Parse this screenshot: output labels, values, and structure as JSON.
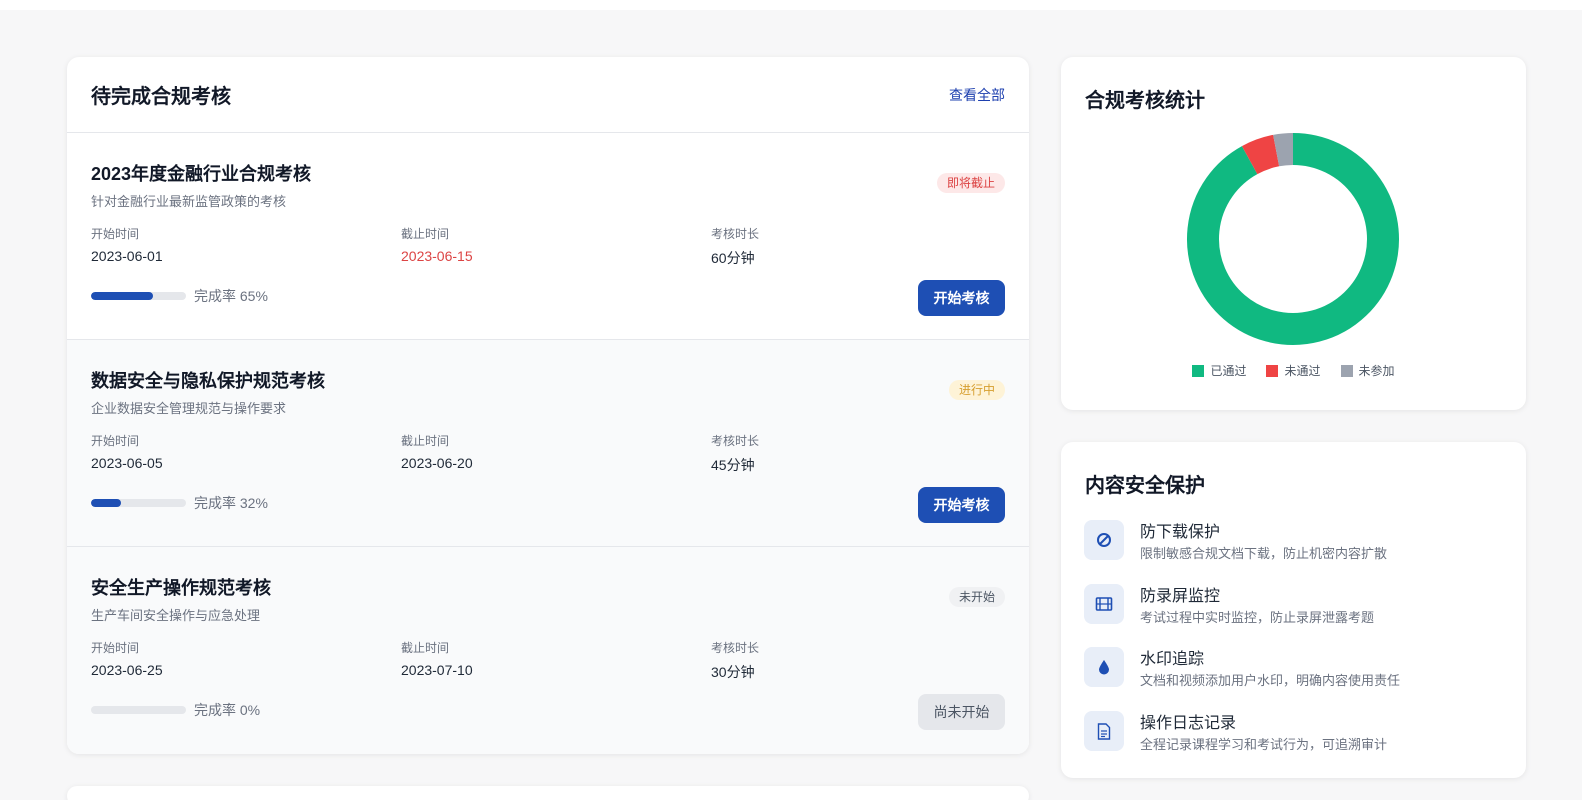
{
  "pending": {
    "title": "待完成合规考核",
    "view_all": "查看全部",
    "start_label": "开始时间",
    "deadline_label": "截止时间",
    "duration_label": "考核时长",
    "exams": [
      {
        "title": "2023年度金融行业合规考核",
        "desc": "针对金融行业最新监管政策的考核",
        "status": "即将截止",
        "status_color": "#dc4444",
        "start": "2023-06-01",
        "deadline": "2023-06-15",
        "duration": "60分钟",
        "progress": 65,
        "progress_text": "完成率 65%",
        "button": "开始考核",
        "button_enabled": true
      },
      {
        "title": "数据安全与隐私保护规范考核",
        "desc": "企业数据安全管理规范与操作要求",
        "status": "进行中",
        "status_color": "#d69e2e",
        "start": "2023-06-05",
        "deadline": "2023-06-20",
        "duration": "45分钟",
        "progress": 32,
        "progress_text": "完成率 32%",
        "button": "开始考核",
        "button_enabled": true
      },
      {
        "title": "安全生产操作规范考核",
        "desc": "生产车间安全操作与应急处理",
        "status": "未开始",
        "status_color": "#4b5563",
        "start": "2023-06-25",
        "deadline": "2023-07-10",
        "duration": "30分钟",
        "progress": 0,
        "progress_text": "完成率 0%",
        "button": "尚未开始",
        "button_enabled": false
      }
    ]
  },
  "stats": {
    "title": "合规考核统计",
    "chart_data": {
      "type": "pie",
      "categories": [
        "已通过",
        "未通过",
        "未参加"
      ],
      "values": [
        92,
        5,
        3
      ],
      "colors": [
        "#10b981",
        "#ef4444",
        "#9ca3af"
      ],
      "legend_position": "bottom"
    }
  },
  "security": {
    "title": "内容安全保护",
    "features": [
      {
        "icon": "no-download-icon",
        "name": "防下载保护",
        "desc": "限制敏感合规文档下载，防止机密内容扩散"
      },
      {
        "icon": "film-icon",
        "name": "防录屏监控",
        "desc": "考试过程中实时监控，防止录屏泄露考题"
      },
      {
        "icon": "droplet-icon",
        "name": "水印追踪",
        "desc": "文档和视频添加用户水印，明确内容使用责任"
      },
      {
        "icon": "document-icon",
        "name": "操作日志记录",
        "desc": "全程记录课程学习和考试行为，可追溯审计"
      }
    ]
  },
  "colors": {
    "primary": "#1e4fb4",
    "danger": "#dc4444",
    "warning": "#d69e2e",
    "success": "#10b981"
  }
}
